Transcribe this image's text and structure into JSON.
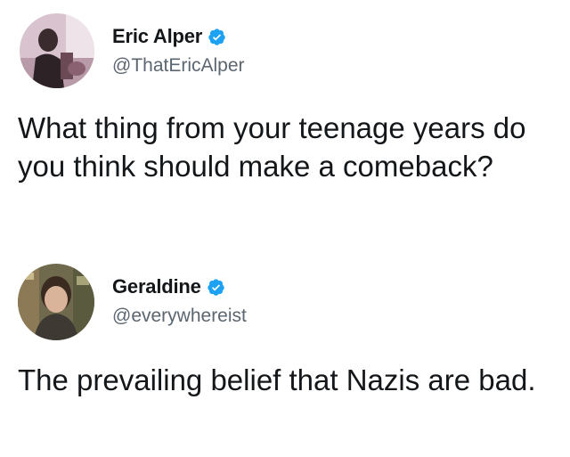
{
  "tweets": [
    {
      "display_name": "Eric Alper",
      "handle": "@ThatEricAlper",
      "verified": true,
      "avatar_icon": "profile-photo-eric",
      "text": "What thing from your teenage years do you think should make a comeback?"
    },
    {
      "display_name": "Geraldine",
      "handle": "@everywhereist",
      "verified": true,
      "avatar_icon": "profile-photo-geraldine",
      "text": "The prevailing belief that Nazis are bad."
    }
  ],
  "colors": {
    "verified_badge": "#1da1f2",
    "handle_text": "#5b6670",
    "body_text": "#14171a"
  }
}
